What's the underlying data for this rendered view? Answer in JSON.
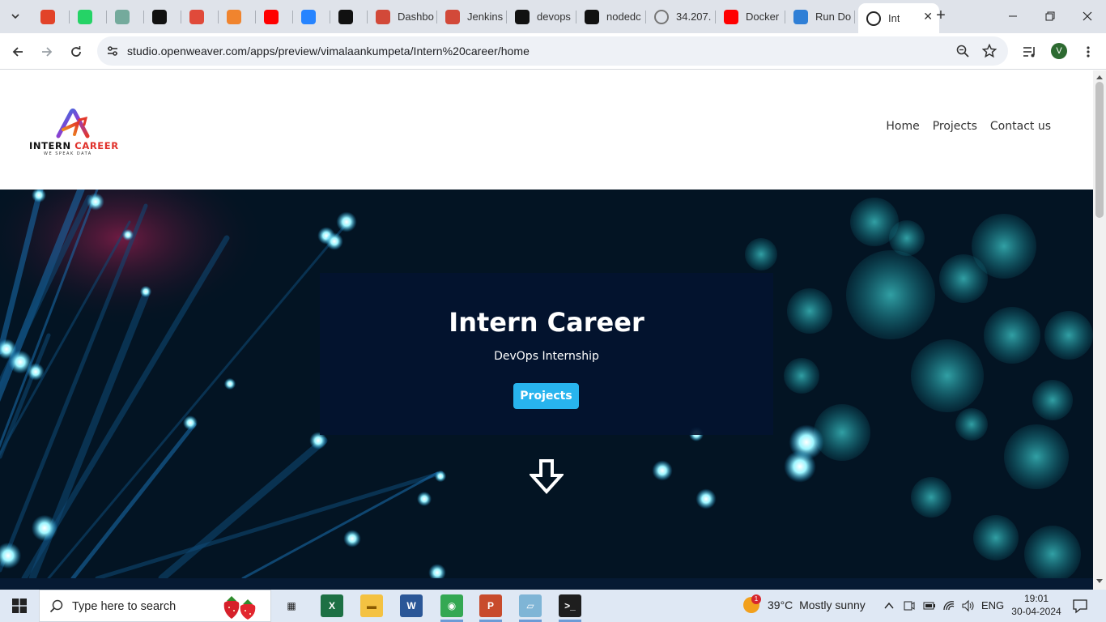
{
  "browser": {
    "tabs": [
      {
        "label": "",
        "icon": "gitlab-icon",
        "color": "#e24329"
      },
      {
        "label": "",
        "icon": "whatsapp-icon",
        "color": "#25d366"
      },
      {
        "label": "",
        "icon": "chatgpt-icon",
        "color": "#74aa9c"
      },
      {
        "label": "",
        "icon": "github-icon",
        "color": "#111111"
      },
      {
        "label": "",
        "icon": "pen-icon",
        "color": "#e04a3a"
      },
      {
        "label": "",
        "icon": "stackblitz-icon",
        "color": "#f0842e"
      },
      {
        "label": "",
        "icon": "youtube-icon",
        "color": "#ff0000"
      },
      {
        "label": "",
        "icon": "confluence-icon",
        "color": "#2684ff"
      },
      {
        "label": "",
        "icon": "github-icon",
        "color": "#111111"
      },
      {
        "label": "Dashbo",
        "icon": "jenkins-icon",
        "color": "#d24939"
      },
      {
        "label": "Jenkins",
        "icon": "jenkins-icon",
        "color": "#d24939"
      },
      {
        "label": "devops",
        "icon": "github-icon",
        "color": "#111111"
      },
      {
        "label": "nodedc",
        "icon": "github-icon",
        "color": "#111111"
      },
      {
        "label": "34.207.",
        "icon": "globe-icon",
        "color": "#777777"
      },
      {
        "label": "Docker",
        "icon": "youtube-icon",
        "color": "#ff0000"
      },
      {
        "label": "Run Do",
        "icon": "edge-icon",
        "color": "#2f7fd6"
      },
      {
        "label": "Int",
        "icon": "globe-icon",
        "color": "#222222"
      }
    ],
    "url": "studio.openweaver.com/apps/preview/vimalaankumpeta/Intern%20career/home",
    "profile_initial": "V"
  },
  "site": {
    "logo": {
      "word1": "INTERN ",
      "word2": "CAREER",
      "tagline": "WE SPEAK DATA"
    },
    "nav": [
      "Home",
      "Projects",
      "Contact us"
    ],
    "hero": {
      "title": "Intern Career",
      "subtitle": "DevOps Internship",
      "button": "Projects"
    }
  },
  "taskbar": {
    "search_placeholder": "Type here to search",
    "apps": [
      "task-view-icon",
      "excel-icon",
      "file-explorer-icon",
      "word-icon",
      "chrome-icon",
      "powerpoint-icon",
      "app-icon",
      "terminal-icon"
    ],
    "weather": {
      "temp": "39°C",
      "condition": "Mostly sunny",
      "badge": "1"
    },
    "language": "ENG",
    "time": "19:01",
    "date": "30-04-2024"
  }
}
